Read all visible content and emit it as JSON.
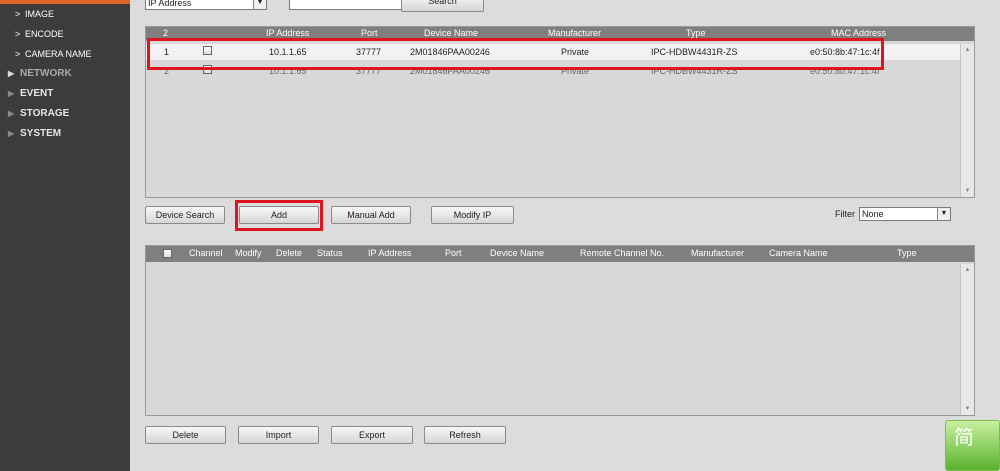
{
  "sidebar": {
    "sub_items": [
      "IMAGE",
      "ENCODE",
      "CAMERA NAME"
    ],
    "main_items": [
      "NETWORK",
      "EVENT",
      "STORAGE",
      "SYSTEM"
    ],
    "chevron": ">",
    "triangle": "▶"
  },
  "search_bar": {
    "type_select": "IP Address",
    "search_button": "Search"
  },
  "device_table": {
    "headers": [
      "2",
      "IP Address",
      "Port",
      "Device Name",
      "Manufacturer",
      "Type",
      "MAC Address"
    ],
    "rows": [
      {
        "no": "1",
        "ip": "10.1.1.65",
        "port": "37777",
        "device_name": "2M01846PAA00246",
        "manufacturer": "Private",
        "type": "IPC-HDBW4431R-ZS",
        "mac": "e0:50:8b:47:1c:4f"
      },
      {
        "no": "2",
        "ip": "10.1.1.65",
        "port": "37777",
        "device_name": "2M01846PAA00246",
        "manufacturer": "Private",
        "type": "IPC-HDBW4431R-ZS",
        "mac": "e0:50:8b:47:1c:4f"
      }
    ]
  },
  "actions": {
    "device_search": "Device Search",
    "add": "Add",
    "manual_add": "Manual Add",
    "modify_ip": "Modify IP",
    "filter_label": "Filter",
    "filter_value": "None"
  },
  "added_table": {
    "headers": [
      "Channel",
      "Modify",
      "Delete",
      "Status",
      "IP Address",
      "Port",
      "Device Name",
      "Remote Channel No.",
      "Manufacturer",
      "Camera Name",
      "Type"
    ]
  },
  "bottom_actions": {
    "delete": "Delete",
    "import": "Import",
    "export": "Export",
    "refresh": "Refresh"
  },
  "corner_badge": {
    "text": "简"
  },
  "colors": {
    "highlight": "#e0141e",
    "accent": "#e0662c"
  }
}
